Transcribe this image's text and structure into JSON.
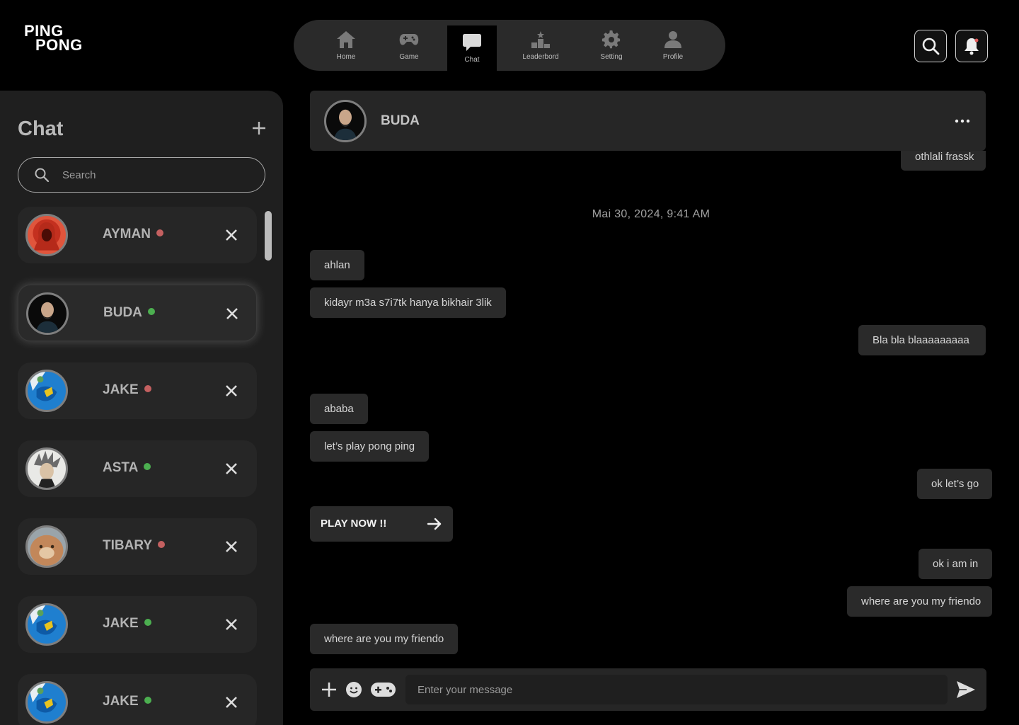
{
  "logo": {
    "line1": "PING",
    "line2": "PONG"
  },
  "nav": [
    {
      "label": "Home",
      "icon": "home-icon"
    },
    {
      "label": "Game",
      "icon": "gamepad-icon"
    },
    {
      "label": "Chat",
      "icon": "chat-icon",
      "active": true
    },
    {
      "label": "Leaderbord",
      "icon": "podium-icon"
    },
    {
      "label": "Setting",
      "icon": "gear-icon"
    },
    {
      "label": "Profile",
      "icon": "user-icon"
    }
  ],
  "topright": {
    "search_icon": "search-icon",
    "bell_icon": "bell-icon",
    "notification_color": "#e05a5a"
  },
  "sidebar": {
    "title": "Chat",
    "search_placeholder": "Search",
    "contacts": [
      {
        "name": "AYMAN",
        "status": "offline"
      },
      {
        "name": "BUDA",
        "status": "online",
        "selected": true
      },
      {
        "name": "JAKE",
        "status": "offline"
      },
      {
        "name": "ASTA",
        "status": "online"
      },
      {
        "name": "TIBARY",
        "status": "offline"
      },
      {
        "name": "JAKE",
        "status": "online"
      },
      {
        "name": "JAKE",
        "status": "online"
      }
    ]
  },
  "colors": {
    "online": "#4caf50",
    "offline": "#c46060",
    "panel": "#1f1f1f",
    "bubble": "#2a2a2a"
  },
  "chat": {
    "header_name": "BUDA",
    "date": "Mai 30, 2024, 9:41 AM",
    "messages": [
      {
        "text": "othlali frassk",
        "side": "right"
      },
      {
        "text": "ahlan",
        "side": "left"
      },
      {
        "text": "kidayr m3a s7i7tk hanya bikhair 3lik",
        "side": "left"
      },
      {
        "text": "Bla bla blaaaaaaaaa",
        "side": "right"
      },
      {
        "text": "ababa",
        "side": "left"
      },
      {
        "text": "let’s play pong ping",
        "side": "left"
      },
      {
        "text": "ok let’s go",
        "side": "right"
      },
      {
        "text": "ok i am in",
        "side": "right"
      },
      {
        "text": "where are you my friendo",
        "side": "right"
      },
      {
        "text": "where are you my friendo",
        "side": "left"
      }
    ],
    "play_button": "PLAY NOW !!",
    "input_placeholder": "Enter your message"
  }
}
